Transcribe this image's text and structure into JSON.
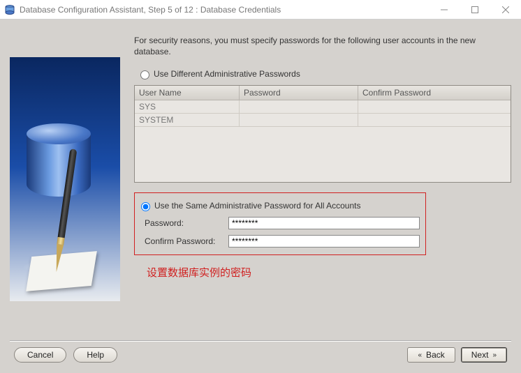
{
  "window": {
    "title": "Database Configuration Assistant, Step 5 of 12 : Database Credentials"
  },
  "intro": "For security reasons, you must specify passwords for the following user accounts in the new database.",
  "options": {
    "different": {
      "label": "Use Different Administrative Passwords",
      "selected": false
    },
    "same": {
      "label": "Use the Same Administrative Password for All Accounts",
      "selected": true
    }
  },
  "table": {
    "headers": [
      "User Name",
      "Password",
      "Confirm Password"
    ],
    "rows": [
      {
        "user": "SYS",
        "password": "",
        "confirm": ""
      },
      {
        "user": "SYSTEM",
        "password": "",
        "confirm": ""
      }
    ]
  },
  "same_pw": {
    "password_label": "Password:",
    "password_value": "********",
    "confirm_label": "Confirm Password:",
    "confirm_value": "********"
  },
  "annotation": "设置数据库实例的密码",
  "buttons": {
    "cancel": "Cancel",
    "help": "Help",
    "back_prefix": "B",
    "back_rest": "ack",
    "next_prefix": "N",
    "next_rest": "ext"
  }
}
